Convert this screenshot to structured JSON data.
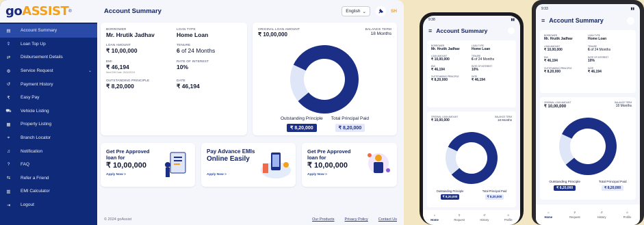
{
  "brand": {
    "logo_go": "go",
    "logo_assist": "ASSIST",
    "logo_mark": "®"
  },
  "colors": {
    "primary": "#0f2a78",
    "accent": "#f5a01a",
    "outstanding": "#1b2f86",
    "paid": "#dfe6f8",
    "background": "#f3e6c2"
  },
  "sidebar": {
    "items": [
      {
        "label": "Account Summary",
        "icon": "account-summary-icon",
        "active": true
      },
      {
        "label": "Loan Top Up",
        "icon": "loan-top-up-icon"
      },
      {
        "label": "Disbursement Details",
        "icon": "disbursement-icon"
      },
      {
        "label": "Service Request",
        "icon": "service-request-icon",
        "expandable": true
      },
      {
        "label": "Payment History",
        "icon": "history-icon"
      },
      {
        "label": "Easy Pay",
        "icon": "easy-pay-icon"
      },
      {
        "label": "Vehicle Listing",
        "icon": "vehicle-icon"
      },
      {
        "label": "Property Listing",
        "icon": "property-icon"
      },
      {
        "label": "Branch Locator",
        "icon": "location-pin-icon"
      },
      {
        "label": "Notification",
        "icon": "bell-icon"
      },
      {
        "label": "FAQ",
        "icon": "question-icon"
      },
      {
        "label": "Refer a Friend",
        "icon": "refer-icon"
      },
      {
        "label": "EMI Calculator",
        "icon": "calculator-icon"
      },
      {
        "label": "Logout",
        "icon": "logout-icon"
      }
    ]
  },
  "header": {
    "title": "Account Summary",
    "language": "English",
    "avatar_initials": "SH"
  },
  "loan": {
    "borrower_label": "BORROWER",
    "borrower": "Mr. Hrutik Jadhav",
    "loan_type_label": "LOAN TYPE",
    "loan_type": "Home Loan",
    "loan_amount_label": "LOAN AMOUNT",
    "loan_amount": "₹ 10,00,000",
    "tenure_label": "TENURE",
    "tenure_prefix": "6",
    "tenure_suffix": " of 24 Months",
    "emi_label": "EMI",
    "emi": "₹ 46,194",
    "emi_due": "Next EMI Date: 25/10/2024",
    "roi_label": "RATE OF INTEREST",
    "roi": "10%",
    "outstanding_label": "OUTSTANDING PRINCIPLE",
    "outstanding": "₹ 8,20,000",
    "date_label": "DATE",
    "date_value": "₹ 46,194"
  },
  "chart_card": {
    "original_label": "ORIGINAL LOAN AMOUNT",
    "original_value": "₹ 10,00,000",
    "balance_label": "BALANCE TERM",
    "balance_value": "18 Months",
    "legend_outstanding": "Outstanding Principle",
    "legend_outstanding_value": "₹ 8,20,000",
    "legend_paid": "Total Principal Paid",
    "legend_paid_value": "₹ 8,20,000"
  },
  "chart_data": {
    "type": "pie",
    "donut": true,
    "labels": [
      "Outstanding Principle",
      "Total Principal Paid"
    ],
    "values": [
      82,
      18
    ],
    "colors": [
      "#1b2f86",
      "#dfe6f8"
    ]
  },
  "promos": [
    {
      "title_1": "Get Pre Approved",
      "title_2": "loan for",
      "amount": "₹ 10,00,000",
      "cta": "Apply Now >"
    },
    {
      "title_1": "Pay Advance EMIs",
      "title_2": "Online Easily",
      "amount": "",
      "cta": "Apply Now >"
    },
    {
      "title_1": "Get Pre Approved",
      "title_2": "loan for",
      "amount": "₹ 10,00,000",
      "cta": "Apply Now >"
    }
  ],
  "footer": {
    "copyright": "© 2024 goAssist",
    "links": [
      "Our Products",
      "Privacy Policy",
      "Contact Us"
    ]
  },
  "phone1": {
    "time": "9:38",
    "title": "Account Summary",
    "tabs": [
      "Home",
      "Request",
      "History",
      "Profile"
    ]
  },
  "phone2": {
    "time": "9:33",
    "title": "Account Summary",
    "tabs": [
      "Home",
      "Request",
      "History",
      "Profile"
    ]
  }
}
